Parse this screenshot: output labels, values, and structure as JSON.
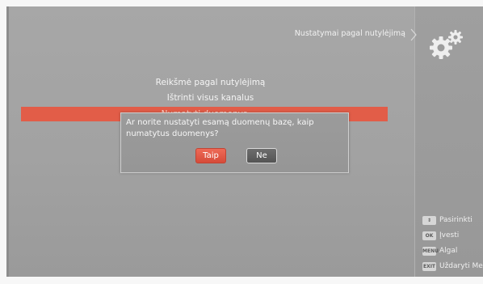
{
  "header": {
    "title": "Nustatymai pagal nutylėjimą"
  },
  "menu": {
    "items": [
      {
        "label": "Reikšmė pagal nutylėjimą"
      },
      {
        "label": "Ištrinti visus kanalus"
      },
      {
        "label": "Numatyti duomenys"
      }
    ]
  },
  "dialog": {
    "message": "Ar norite nustatyti esamą duomenų bazę, kaip numatytus duomenys?",
    "yes_label": "Taip",
    "no_label": "Ne"
  },
  "hints": {
    "select": {
      "key": "⇕",
      "label": "Pasirinkti"
    },
    "ok": {
      "key": "OK",
      "label": "Įvesti"
    },
    "menu": {
      "key": "MENU",
      "label": "Algal"
    },
    "exit": {
      "key": "EXIT",
      "label": "Uždaryti Me"
    }
  },
  "colors": {
    "highlight": "#e25d48",
    "screen_bg": "#a5a5a5",
    "button_yes": "#e35a47"
  },
  "icons": {
    "settings": "gear-icon",
    "chevron": "chevron-right-icon"
  }
}
